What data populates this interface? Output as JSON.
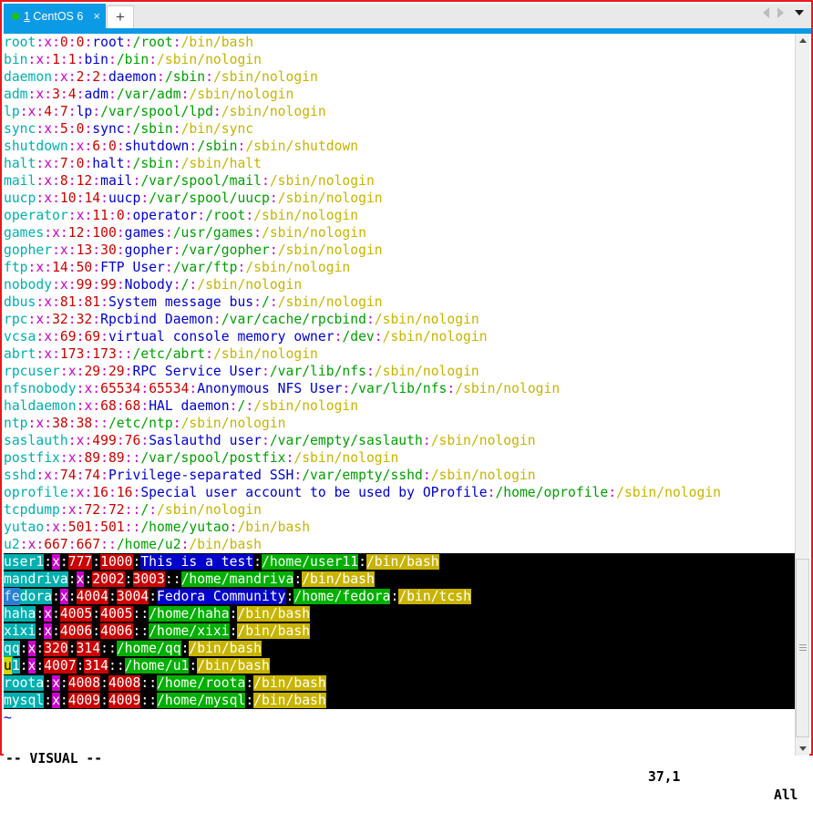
{
  "window": {
    "accent_color": "#e8191e",
    "tab_active_color": "#0b9ae6"
  },
  "tabbar": {
    "tab_index": "1",
    "tab_title": " CentOS 6",
    "tab_full_label": "1 CentOS 6",
    "close_glyph": "×",
    "new_tab_glyph": "+",
    "status_dot": "connected"
  },
  "terminal": {
    "app": "vim",
    "file": "/etc/passwd",
    "tilde_filler": "~",
    "lines": [
      {
        "selected": false,
        "user": "root",
        "x": "x",
        "uid": "0",
        "gid": "0",
        "comment": "root",
        "home": "/root",
        "shell": "/bin/bash"
      },
      {
        "selected": false,
        "user": "bin",
        "x": "x",
        "uid": "1",
        "gid": "1",
        "comment": "bin",
        "home": "/bin",
        "shell": "/sbin/nologin"
      },
      {
        "selected": false,
        "user": "daemon",
        "x": "x",
        "uid": "2",
        "gid": "2",
        "comment": "daemon",
        "home": "/sbin",
        "shell": "/sbin/nologin"
      },
      {
        "selected": false,
        "user": "adm",
        "x": "x",
        "uid": "3",
        "gid": "4",
        "comment": "adm",
        "home": "/var/adm",
        "shell": "/sbin/nologin"
      },
      {
        "selected": false,
        "user": "lp",
        "x": "x",
        "uid": "4",
        "gid": "7",
        "comment": "lp",
        "home": "/var/spool/lpd",
        "shell": "/sbin/nologin"
      },
      {
        "selected": false,
        "user": "sync",
        "x": "x",
        "uid": "5",
        "gid": "0",
        "comment": "sync",
        "home": "/sbin",
        "shell": "/bin/sync"
      },
      {
        "selected": false,
        "user": "shutdown",
        "x": "x",
        "uid": "6",
        "gid": "0",
        "comment": "shutdown",
        "home": "/sbin",
        "shell": "/sbin/shutdown"
      },
      {
        "selected": false,
        "user": "halt",
        "x": "x",
        "uid": "7",
        "gid": "0",
        "comment": "halt",
        "home": "/sbin",
        "shell": "/sbin/halt"
      },
      {
        "selected": false,
        "user": "mail",
        "x": "x",
        "uid": "8",
        "gid": "12",
        "comment": "mail",
        "home": "/var/spool/mail",
        "shell": "/sbin/nologin"
      },
      {
        "selected": false,
        "user": "uucp",
        "x": "x",
        "uid": "10",
        "gid": "14",
        "comment": "uucp",
        "home": "/var/spool/uucp",
        "shell": "/sbin/nologin"
      },
      {
        "selected": false,
        "user": "operator",
        "x": "x",
        "uid": "11",
        "gid": "0",
        "comment": "operator",
        "home": "/root",
        "shell": "/sbin/nologin"
      },
      {
        "selected": false,
        "user": "games",
        "x": "x",
        "uid": "12",
        "gid": "100",
        "comment": "games",
        "home": "/usr/games",
        "shell": "/sbin/nologin"
      },
      {
        "selected": false,
        "user": "gopher",
        "x": "x",
        "uid": "13",
        "gid": "30",
        "comment": "gopher",
        "home": "/var/gopher",
        "shell": "/sbin/nologin"
      },
      {
        "selected": false,
        "user": "ftp",
        "x": "x",
        "uid": "14",
        "gid": "50",
        "comment": "FTP User",
        "home": "/var/ftp",
        "shell": "/sbin/nologin"
      },
      {
        "selected": false,
        "user": "nobody",
        "x": "x",
        "uid": "99",
        "gid": "99",
        "comment": "Nobody",
        "home": "/",
        "shell": "/sbin/nologin"
      },
      {
        "selected": false,
        "user": "dbus",
        "x": "x",
        "uid": "81",
        "gid": "81",
        "comment": "System message bus",
        "home": "/",
        "shell": "/sbin/nologin"
      },
      {
        "selected": false,
        "user": "rpc",
        "x": "x",
        "uid": "32",
        "gid": "32",
        "comment": "Rpcbind Daemon",
        "home": "/var/cache/rpcbind",
        "shell": "/sbin/nologin"
      },
      {
        "selected": false,
        "user": "vcsa",
        "x": "x",
        "uid": "69",
        "gid": "69",
        "comment": "virtual console memory owner",
        "home": "/dev",
        "shell": "/sbin/nologin"
      },
      {
        "selected": false,
        "user": "abrt",
        "x": "x",
        "uid": "173",
        "gid": "173",
        "comment": "",
        "home": "/etc/abrt",
        "shell": "/sbin/nologin"
      },
      {
        "selected": false,
        "user": "rpcuser",
        "x": "x",
        "uid": "29",
        "gid": "29",
        "comment": "RPC Service User",
        "home": "/var/lib/nfs",
        "shell": "/sbin/nologin"
      },
      {
        "selected": false,
        "user": "nfsnobody",
        "x": "x",
        "uid": "65534",
        "gid": "65534",
        "comment": "Anonymous NFS User",
        "home": "/var/lib/nfs",
        "shell": "/sbin/nologin"
      },
      {
        "selected": false,
        "user": "haldaemon",
        "x": "x",
        "uid": "68",
        "gid": "68",
        "comment": "HAL daemon",
        "home": "/",
        "shell": "/sbin/nologin"
      },
      {
        "selected": false,
        "user": "ntp",
        "x": "x",
        "uid": "38",
        "gid": "38",
        "comment": "",
        "home": "/etc/ntp",
        "shell": "/sbin/nologin"
      },
      {
        "selected": false,
        "user": "saslauth",
        "x": "x",
        "uid": "499",
        "gid": "76",
        "comment": "Saslauthd user",
        "home": "/var/empty/saslauth",
        "shell": "/sbin/nologin"
      },
      {
        "selected": false,
        "user": "postfix",
        "x": "x",
        "uid": "89",
        "gid": "89",
        "comment": "",
        "home": "/var/spool/postfix",
        "shell": "/sbin/nologin"
      },
      {
        "selected": false,
        "user": "sshd",
        "x": "x",
        "uid": "74",
        "gid": "74",
        "comment": "Privilege-separated SSH",
        "home": "/var/empty/sshd",
        "shell": "/sbin/nologin"
      },
      {
        "selected": false,
        "user": "oprofile",
        "x": "x",
        "uid": "16",
        "gid": "16",
        "comment": "Special user account to be used by OProfile",
        "home": "/home/oprofile",
        "shell": "/sbin/nologin"
      },
      {
        "selected": false,
        "user": "tcpdump",
        "x": "x",
        "uid": "72",
        "gid": "72",
        "comment": "",
        "home": "/",
        "shell": "/sbin/nologin"
      },
      {
        "selected": false,
        "user": "yutao",
        "x": "x",
        "uid": "501",
        "gid": "501",
        "comment": "",
        "home": "/home/yutao",
        "shell": "/bin/bash"
      },
      {
        "selected": false,
        "user": "u2",
        "x": "x",
        "uid": "667",
        "gid": "667",
        "comment": "",
        "home": "/home/u2",
        "shell": "/bin/bash"
      },
      {
        "selected": true,
        "user": "user1",
        "x": "x",
        "uid": "777",
        "gid": "1000",
        "comment": "This is a test",
        "home": "/home/user11",
        "shell": "/bin/bash"
      },
      {
        "selected": true,
        "user": "mandriva",
        "x": "x",
        "uid": "2002",
        "gid": "3003",
        "comment": "",
        "home": "/home/mandriva",
        "shell": "/bin/bash"
      },
      {
        "selected": true,
        "user": "fedora",
        "x": "x",
        "uid": "4004",
        "gid": "3004",
        "comment": "Fedora Community",
        "home": "/home/fedora",
        "shell": "/bin/tcsh",
        "cursor": "ime"
      },
      {
        "selected": true,
        "user": "haha",
        "x": "x",
        "uid": "4005",
        "gid": "4005",
        "comment": "",
        "home": "/home/haha",
        "shell": "/bin/bash"
      },
      {
        "selected": true,
        "user": "xixi",
        "x": "x",
        "uid": "4006",
        "gid": "4006",
        "comment": "",
        "home": "/home/xixi",
        "shell": "/bin/bash"
      },
      {
        "selected": true,
        "user": "qq",
        "x": "x",
        "uid": "320",
        "gid": "314",
        "comment": "",
        "home": "/home/qq",
        "shell": "/bin/bash"
      },
      {
        "selected": true,
        "user": "u1",
        "x": "x",
        "uid": "4007",
        "gid": "314",
        "comment": "",
        "home": "/home/u1",
        "shell": "/bin/bash",
        "cursor": "box"
      },
      {
        "selected": true,
        "user": "roota",
        "x": "x",
        "uid": "4008",
        "gid": "4008",
        "comment": "",
        "home": "/home/roota",
        "shell": "/bin/bash"
      },
      {
        "selected": true,
        "user": "mysql",
        "x": "x",
        "uid": "4009",
        "gid": "4009",
        "comment": "",
        "home": "/home/mysql",
        "shell": "/bin/bash"
      }
    ]
  },
  "statusline": {
    "mode": "-- VISUAL --",
    "position": "37,1",
    "scroll": "All"
  },
  "scrollbar": {
    "up_glyph": "▲",
    "down_glyph": "▼"
  }
}
